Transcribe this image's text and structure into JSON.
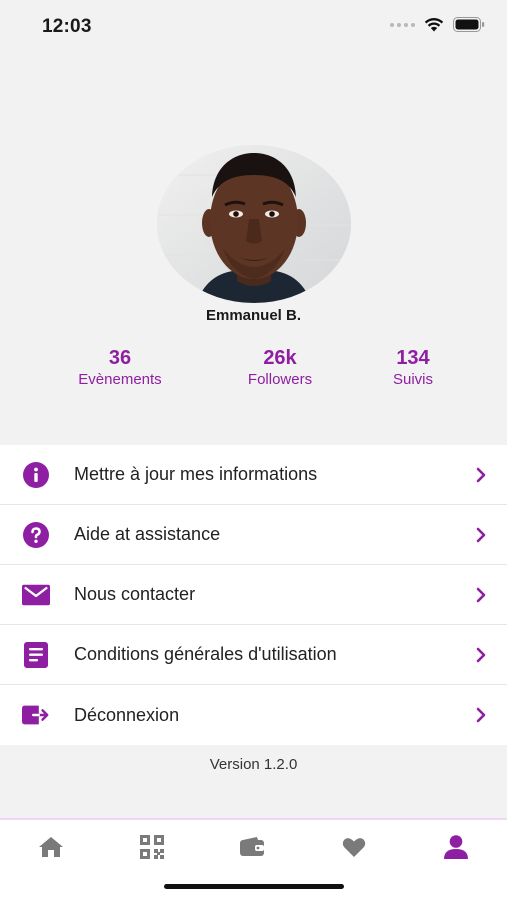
{
  "status_bar": {
    "time": "12:03"
  },
  "profile": {
    "name": "Emmanuel B.",
    "stats": [
      {
        "value": "36",
        "label": "Evènements"
      },
      {
        "value": "26k",
        "label": "Followers"
      },
      {
        "value": "134",
        "label": "Suivis"
      }
    ]
  },
  "menu": {
    "items": [
      {
        "label": "Mettre à jour mes informations",
        "icon": "info-icon"
      },
      {
        "label": "Aide at assistance",
        "icon": "help-icon"
      },
      {
        "label": "Nous contacter",
        "icon": "mail-icon"
      },
      {
        "label": "Conditions générales d'utilisation",
        "icon": "document-icon"
      },
      {
        "label": "Déconnexion",
        "icon": "logout-icon"
      }
    ]
  },
  "version": "Version 1.2.0",
  "tab_bar": {
    "tabs": [
      "home-icon",
      "qr-code-icon",
      "wallet-icon",
      "heart-icon",
      "profile-icon"
    ],
    "active": "profile-icon"
  },
  "colors": {
    "accent": "#8e1fa2",
    "tab_inactive": "#7a7a7a",
    "background": "#f2f2f2"
  }
}
